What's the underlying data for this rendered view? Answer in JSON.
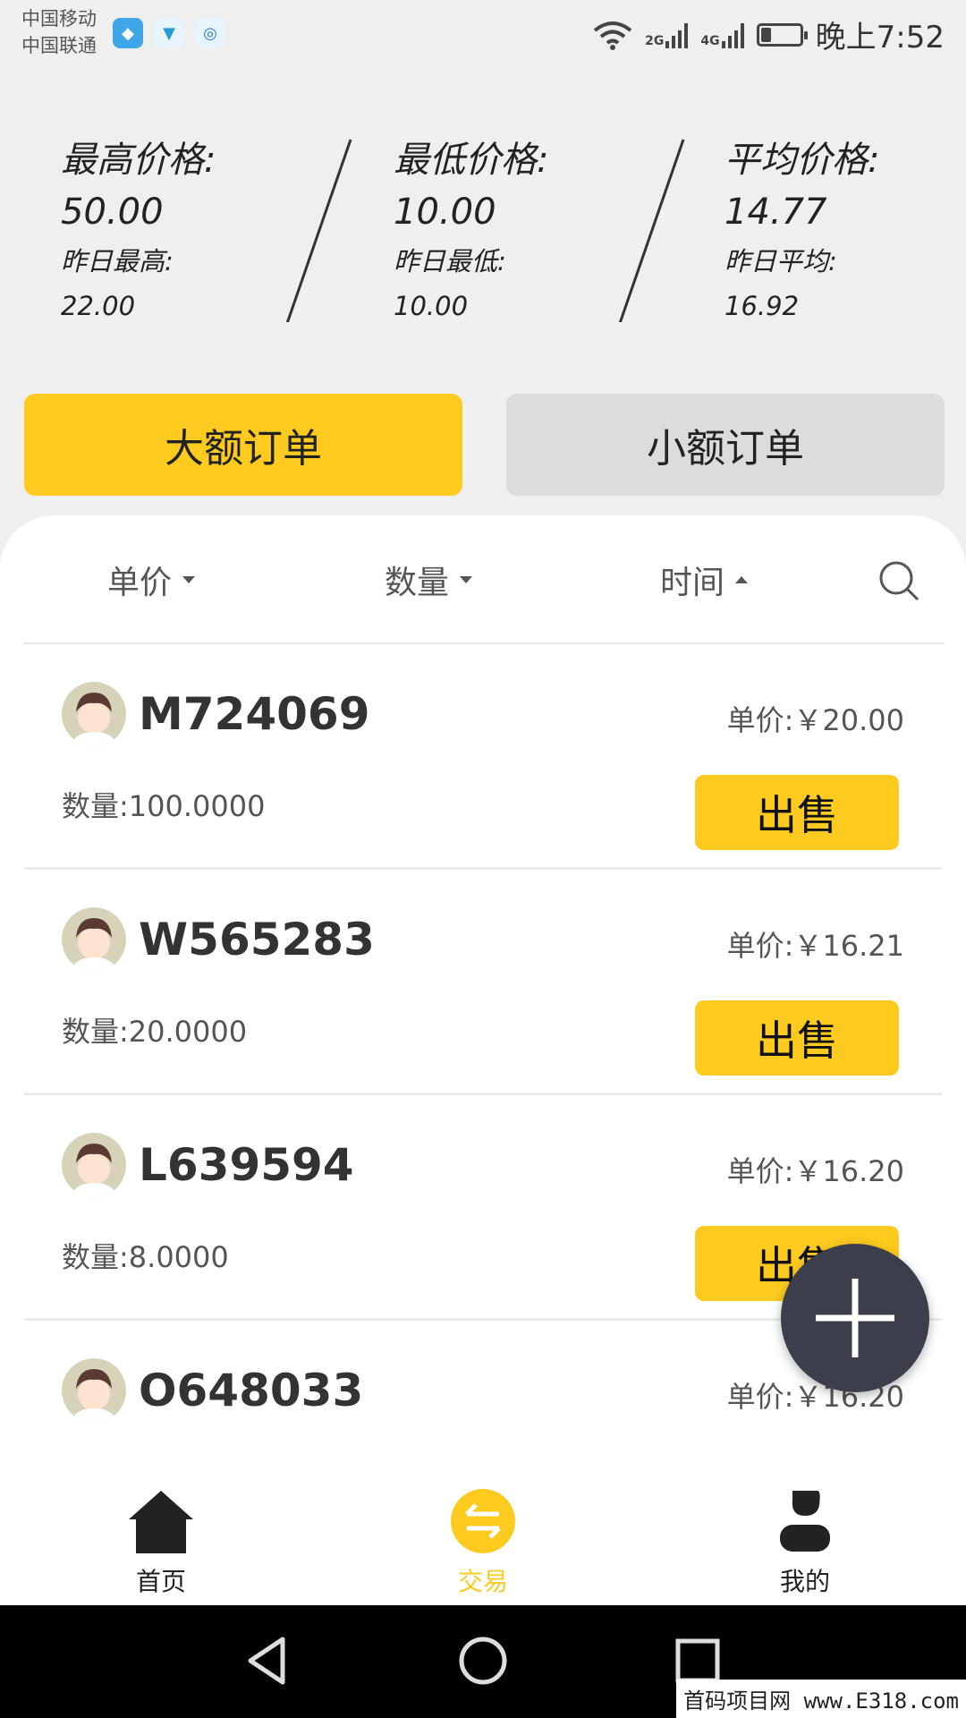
{
  "status_bar": {
    "carrier1": "中国移动",
    "carrier2": "中国联通",
    "net1": "2G",
    "net2": "4G",
    "time": "晚上7:52",
    "battery_level": 0.25
  },
  "stats": [
    {
      "title": "最高价格:",
      "value": "50.00",
      "sub_title": "昨日最高:",
      "sub_value": "22.00"
    },
    {
      "title": "最低价格:",
      "value": "10.00",
      "sub_title": "昨日最低:",
      "sub_value": "10.00"
    },
    {
      "title": "平均价格:",
      "value": "14.77",
      "sub_title": "昨日平均:",
      "sub_value": "16.92"
    }
  ],
  "tabs": {
    "large": "大额订单",
    "small": "小额订单"
  },
  "filters": {
    "price": "单价",
    "quantity": "数量",
    "time": "时间"
  },
  "orders": [
    {
      "user": "M724069",
      "price": "单价:￥20.00",
      "quantity": "数量:100.0000",
      "action": "出售"
    },
    {
      "user": "W565283",
      "price": "单价:￥16.21",
      "quantity": "数量:20.0000",
      "action": "出售"
    },
    {
      "user": "L639594",
      "price": "单价:￥16.20",
      "quantity": "数量:8.0000",
      "action": "出售"
    },
    {
      "user": "O648033",
      "price": "单价:￥16.20",
      "quantity": "",
      "action": ""
    }
  ],
  "bottom_nav": {
    "home": "首页",
    "trade": "交易",
    "mine": "我的"
  },
  "watermark": "首码项目网 www.E318.com",
  "colors": {
    "accent": "#fdcb1f",
    "fab": "#3c3f4b"
  }
}
